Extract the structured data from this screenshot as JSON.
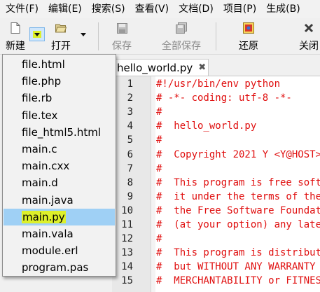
{
  "menubar": {
    "items": [
      "文件(F)",
      "编辑(E)",
      "搜索(S)",
      "查看(V)",
      "文档(D)",
      "项目(P)",
      "生成(B)"
    ]
  },
  "toolbar": {
    "new_label": "新建",
    "open_label": "打开",
    "save_label": "保存",
    "save_all_label": "全部保存",
    "revert_label": "还原",
    "close_label": "关闭"
  },
  "dropdown": {
    "items": [
      "file.html",
      "file.php",
      "file.rb",
      "file.tex",
      "file_html5.html",
      "main.c",
      "main.cxx",
      "main.d",
      "main.java",
      "main.py",
      "main.vala",
      "module.erl",
      "program.pas"
    ],
    "selected_index": 9
  },
  "editor": {
    "tab_title": "hello_world.py",
    "tab_close": "✖",
    "line_numbers": [
      "1",
      "2",
      "3",
      "4",
      "5",
      "6",
      "7",
      "8",
      "9",
      "10",
      "11",
      "12",
      "13",
      "14",
      "15"
    ],
    "lines": [
      "#!/usr/bin/env python",
      "# -*- coding: utf-8 -*-",
      "#",
      "#  hello_world.py",
      "#",
      "#  Copyright 2021 Y <Y@HOST>",
      "#",
      "#  This program is free software",
      "#  it under the terms of the GNU",
      "#  the Free Software Foundation",
      "#  (at your option) any later version.",
      "#",
      "#  This program is distributed",
      "#  but WITHOUT ANY WARRANTY",
      "#  MERCHANTABILITY or FITNESS"
    ]
  },
  "colors": {
    "code_comment": "#e01010",
    "selection": "#9fd0f5",
    "highlight": "#ddf02a"
  }
}
